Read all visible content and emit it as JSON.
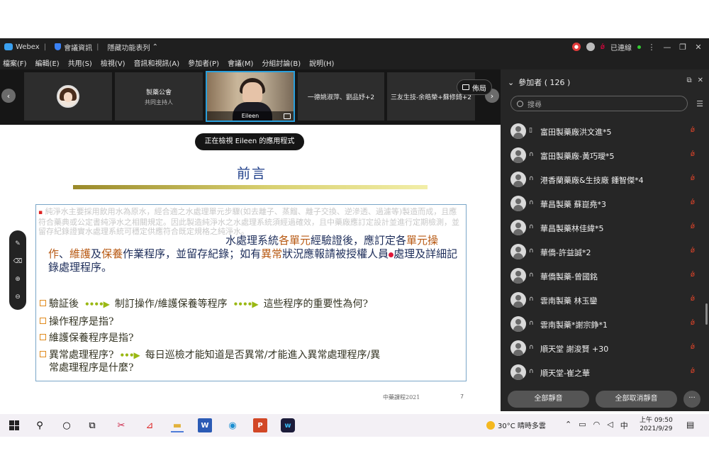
{
  "titlebar": {
    "app": "Webex",
    "meeting_info": "會議資訊",
    "hidden_bar": "隱藏功能表列",
    "status": "已連線"
  },
  "menu": [
    "檔案(F)",
    "編輯(E)",
    "共用(S)",
    "檢視(V)",
    "音訊和視訊(A)",
    "參加者(P)",
    "會議(M)",
    "分組討論(B)",
    "說明(H)"
  ],
  "strip": {
    "tile2_title": "製藥公會",
    "tile2_sub": "共同主持人",
    "cam_name": "Eileen",
    "tile4": "一德姚淑萍、劉品妤+2",
    "tile5": "三友生技-余皓榮+蘇修錡+2",
    "layout": "佈局"
  },
  "content": {
    "viewing": "正在檢視 Eileen 的應用程式",
    "slide_title": "前言",
    "faded": "純淨水主要採用飲用水為原水，經合適之水處理單元步驟(如去離子、蒸餾、離子交換、逆滲透、過濾等)製造而成，且應符合藥典或公定書純淨水之相關規定。因此製造純淨水之水處理系統須經過確效，且中藥廠應訂定設計並進行定期檢測，並留存紀錄證實水處理系統可穩定供應符合既定規格之純淨水。",
    "main_a": "水處理系統",
    "main_b": "各單元",
    "main_c": "經驗證後，應訂定各",
    "main_d": "單元操作",
    "main_e": "、",
    "main_f": "維護",
    "main_g": "及",
    "main_h": "保養",
    "main_i": "作業程序，並留存紀錄；如有",
    "main_j": "異常",
    "main_k": "狀況應報請",
    "main_l": "被授權人員",
    "main_m": "處理及詳細記錄處理程序。",
    "q1a": "驗証後",
    "q1b": "制訂操作/維護保養等程序",
    "q1c": "這些程序的重要性為何?",
    "q2": "操作程序是指?",
    "q3": "維護保養程序是指?",
    "q4a": "異常處理程序?",
    "q4b": "每日巡檢才能知道是否異常/才能進入異常處理程序/異",
    "q4c": "常處理程序是什麼?",
    "footer": "中藥課程2021",
    "page": "7"
  },
  "panel": {
    "title": "參加者 ( 126 )",
    "search_placeholder": "搜尋",
    "participants": [
      "富田製藥廠洪文進*5",
      "富田製藥廠-黃巧璦*5",
      "港香蘭藥廠&生技廠 鍾智傑*4",
      "華昌製藥 蘇崑堯*3",
      "華昌製藥林佳緯*5",
      "華僑-許益誠*2",
      "華僑製藥-曾國銘",
      "雲南製藥 林玉鑾",
      "雲南製藥*謝宗錚*1",
      "順天堂 謝浚賢 +30",
      "順天堂-崔之華"
    ],
    "mute_all": "全部靜音",
    "unmute_all": "全部取消靜音",
    "more": "···"
  },
  "taskbar": {
    "weather": "30°C 晴時多雲",
    "ime": "中",
    "time": "上午 09:50",
    "date": "2021/9/29"
  }
}
